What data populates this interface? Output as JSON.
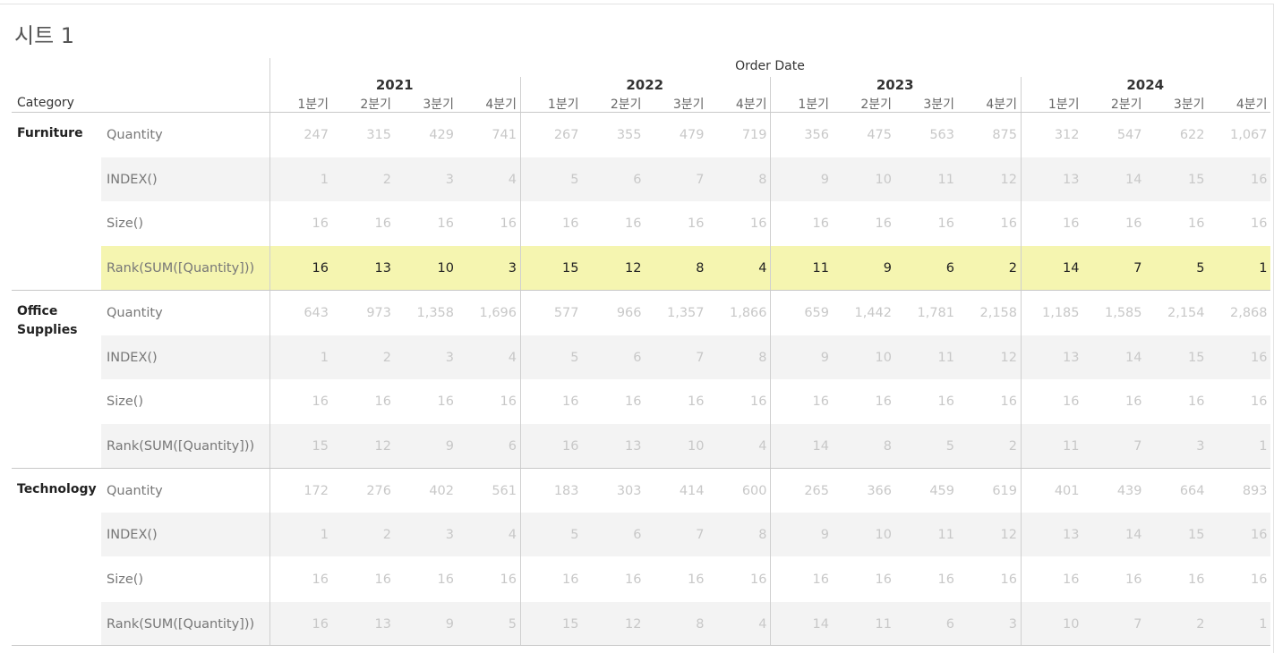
{
  "sheet_title": "시트 1",
  "header": {
    "column_group": "Order Date",
    "category_label": "Category",
    "years": [
      "2021",
      "2022",
      "2023",
      "2024"
    ],
    "quarters": [
      "1분기",
      "2분기",
      "3분기",
      "4분기"
    ]
  },
  "colors": {
    "highlight": "#f5f5b0",
    "stripe": "#f3f3f3",
    "faded_text": "#c8c8c8"
  },
  "categories": [
    {
      "name": "Furniture",
      "rows": [
        {
          "measure": "Quantity",
          "highlighted": false,
          "values": [
            "247",
            "315",
            "429",
            "741",
            "267",
            "355",
            "479",
            "719",
            "356",
            "475",
            "563",
            "875",
            "312",
            "547",
            "622",
            "1,067"
          ]
        },
        {
          "measure": "INDEX()",
          "highlighted": false,
          "values": [
            "1",
            "2",
            "3",
            "4",
            "5",
            "6",
            "7",
            "8",
            "9",
            "10",
            "11",
            "12",
            "13",
            "14",
            "15",
            "16"
          ]
        },
        {
          "measure": "Size()",
          "highlighted": false,
          "values": [
            "16",
            "16",
            "16",
            "16",
            "16",
            "16",
            "16",
            "16",
            "16",
            "16",
            "16",
            "16",
            "16",
            "16",
            "16",
            "16"
          ]
        },
        {
          "measure": "Rank(SUM([Quantity]))",
          "highlighted": true,
          "values": [
            "16",
            "13",
            "10",
            "3",
            "15",
            "12",
            "8",
            "4",
            "11",
            "9",
            "6",
            "2",
            "14",
            "7",
            "5",
            "1"
          ]
        }
      ]
    },
    {
      "name": "Office Supplies",
      "rows": [
        {
          "measure": "Quantity",
          "highlighted": false,
          "values": [
            "643",
            "973",
            "1,358",
            "1,696",
            "577",
            "966",
            "1,357",
            "1,866",
            "659",
            "1,442",
            "1,781",
            "2,158",
            "1,185",
            "1,585",
            "2,154",
            "2,868"
          ]
        },
        {
          "measure": "INDEX()",
          "highlighted": false,
          "values": [
            "1",
            "2",
            "3",
            "4",
            "5",
            "6",
            "7",
            "8",
            "9",
            "10",
            "11",
            "12",
            "13",
            "14",
            "15",
            "16"
          ]
        },
        {
          "measure": "Size()",
          "highlighted": false,
          "values": [
            "16",
            "16",
            "16",
            "16",
            "16",
            "16",
            "16",
            "16",
            "16",
            "16",
            "16",
            "16",
            "16",
            "16",
            "16",
            "16"
          ]
        },
        {
          "measure": "Rank(SUM([Quantity]))",
          "highlighted": false,
          "values": [
            "15",
            "12",
            "9",
            "6",
            "16",
            "13",
            "10",
            "4",
            "14",
            "8",
            "5",
            "2",
            "11",
            "7",
            "3",
            "1"
          ]
        }
      ]
    },
    {
      "name": "Technology",
      "rows": [
        {
          "measure": "Quantity",
          "highlighted": false,
          "values": [
            "172",
            "276",
            "402",
            "561",
            "183",
            "303",
            "414",
            "600",
            "265",
            "366",
            "459",
            "619",
            "401",
            "439",
            "664",
            "893"
          ]
        },
        {
          "measure": "INDEX()",
          "highlighted": false,
          "values": [
            "1",
            "2",
            "3",
            "4",
            "5",
            "6",
            "7",
            "8",
            "9",
            "10",
            "11",
            "12",
            "13",
            "14",
            "15",
            "16"
          ]
        },
        {
          "measure": "Size()",
          "highlighted": false,
          "values": [
            "16",
            "16",
            "16",
            "16",
            "16",
            "16",
            "16",
            "16",
            "16",
            "16",
            "16",
            "16",
            "16",
            "16",
            "16",
            "16"
          ]
        },
        {
          "measure": "Rank(SUM([Quantity]))",
          "highlighted": false,
          "values": [
            "16",
            "13",
            "9",
            "5",
            "15",
            "12",
            "8",
            "4",
            "14",
            "11",
            "6",
            "3",
            "10",
            "7",
            "2",
            "1"
          ]
        }
      ]
    }
  ]
}
